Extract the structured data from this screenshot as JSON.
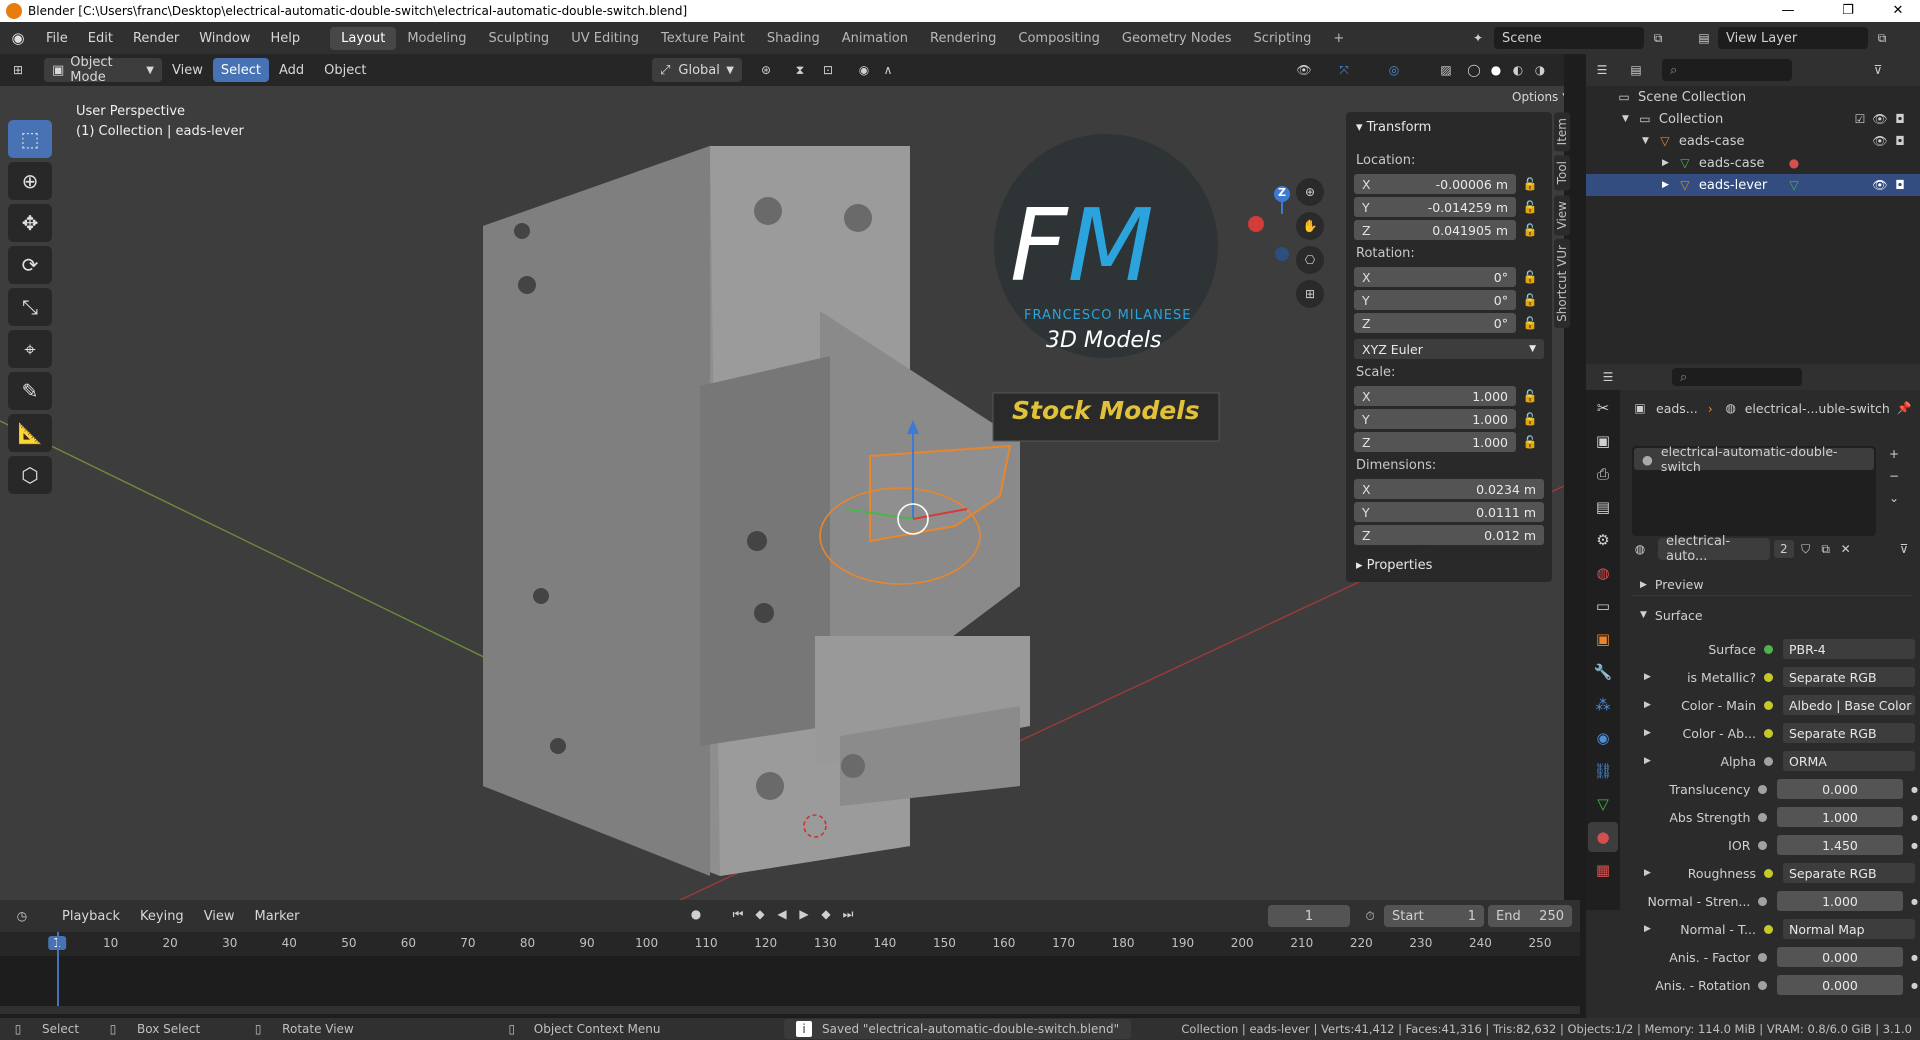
{
  "titlebar": {
    "title": "Blender [C:\\Users\\franc\\Desktop\\electrical-automatic-double-switch\\electrical-automatic-double-switch.blend]",
    "minimize": "—",
    "maximize": "❐",
    "close": "✕"
  },
  "menu": [
    "File",
    "Edit",
    "Render",
    "Window",
    "Help"
  ],
  "workspaces": [
    "Layout",
    "Modeling",
    "Sculpting",
    "UV Editing",
    "Texture Paint",
    "Shading",
    "Animation",
    "Rendering",
    "Compositing",
    "Geometry Nodes",
    "Scripting"
  ],
  "active_workspace": "Layout",
  "add_workspace": "+",
  "scene": {
    "label": "Scene"
  },
  "view_layer": {
    "label": "View Layer"
  },
  "viewport_header": {
    "mode": "Object Mode",
    "menus": [
      "View",
      "Select",
      "Add",
      "Object"
    ],
    "orientation": "Global",
    "options": "Options"
  },
  "viewport": {
    "perspective": "User Perspective",
    "collection_info": "(1) Collection | eads-lever",
    "watermark": {
      "initials_f": "F",
      "initials_m": "M",
      "name": "FRANCESCO MILANESE",
      "sub": "3D Models",
      "banner": "Stock Models"
    },
    "gizmo_axes": {
      "z": "Z"
    }
  },
  "npanel": {
    "header": "Transform",
    "location_label": "Location:",
    "location": [
      {
        "axis": "X",
        "value": "-0.00006 m"
      },
      {
        "axis": "Y",
        "value": "-0.014259 m"
      },
      {
        "axis": "Z",
        "value": "0.041905 m"
      }
    ],
    "rotation_label": "Rotation:",
    "rotation": [
      {
        "axis": "X",
        "value": "0°"
      },
      {
        "axis": "Y",
        "value": "0°"
      },
      {
        "axis": "Z",
        "value": "0°"
      }
    ],
    "rotation_mode": "XYZ Euler",
    "scale_label": "Scale:",
    "scale": [
      {
        "axis": "X",
        "value": "1.000"
      },
      {
        "axis": "Y",
        "value": "1.000"
      },
      {
        "axis": "Z",
        "value": "1.000"
      }
    ],
    "dimensions_label": "Dimensions:",
    "dimensions": [
      {
        "axis": "X",
        "value": "0.0234 m"
      },
      {
        "axis": "Y",
        "value": "0.0111 m"
      },
      {
        "axis": "Z",
        "value": "0.012 m"
      }
    ],
    "properties": "Properties",
    "side_tabs": [
      "Item",
      "Tool",
      "View",
      "Shortcut VUr"
    ]
  },
  "outliner": {
    "rows": [
      {
        "label": "Scene Collection",
        "indent": 0
      },
      {
        "label": "Collection",
        "indent": 1
      },
      {
        "label": "eads-case",
        "indent": 2
      },
      {
        "label": "eads-case",
        "indent": 3
      },
      {
        "label": "eads-lever",
        "indent": 3,
        "selected": true
      }
    ]
  },
  "properties": {
    "breadcrumb_obj": "eads...",
    "breadcrumb_mat": "electrical-...uble-switch",
    "material_slot": "electrical-automatic-double-switch",
    "material_name": "electrical-auto...",
    "user_count": "2",
    "preview": "Preview",
    "surface_header": "Surface",
    "rows": [
      {
        "label": "Surface",
        "value": "PBR-4",
        "socket": "#4db34d",
        "expand": false,
        "num": false
      },
      {
        "label": "is Metallic?",
        "value": "Separate RGB",
        "socket": "#c7c729",
        "expand": true,
        "num": false
      },
      {
        "label": "Color - Main",
        "value": "Albedo | Base Color",
        "socket": "#c7c729",
        "expand": true,
        "num": false
      },
      {
        "label": "Color - Ab...",
        "value": "Separate RGB",
        "socket": "#c7c729",
        "expand": true,
        "num": false
      },
      {
        "label": "Alpha",
        "value": "ORMA",
        "socket": "#a1a1a1",
        "expand": true,
        "num": false
      },
      {
        "label": "Translucency",
        "value": "0.000",
        "socket": "#a1a1a1",
        "expand": false,
        "num": true
      },
      {
        "label": "Abs Strength",
        "value": "1.000",
        "socket": "#a1a1a1",
        "expand": false,
        "num": true
      },
      {
        "label": "IOR",
        "value": "1.450",
        "socket": "#a1a1a1",
        "expand": false,
        "num": true
      },
      {
        "label": "Roughness",
        "value": "Separate RGB",
        "socket": "#c7c729",
        "expand": true,
        "num": false
      },
      {
        "label": "Normal - Stren...",
        "value": "1.000",
        "socket": "#a1a1a1",
        "expand": false,
        "num": true
      },
      {
        "label": "Normal - T...",
        "value": "Normal Map",
        "socket": "#c7c729",
        "expand": true,
        "num": false
      },
      {
        "label": "Anis. - Factor",
        "value": "0.000",
        "socket": "#a1a1a1",
        "expand": false,
        "num": true
      },
      {
        "label": "Anis. - Rotation",
        "value": "0.000",
        "socket": "#a1a1a1",
        "expand": false,
        "num": true
      }
    ]
  },
  "timeline": {
    "menus": [
      "Playback",
      "Keying",
      "View",
      "Marker"
    ],
    "current_frame": "1",
    "start_label": "Start",
    "start": "1",
    "end_label": "End",
    "end": "250",
    "ticks": [
      "1",
      "10",
      "20",
      "30",
      "40",
      "50",
      "60",
      "70",
      "80",
      "90",
      "100",
      "110",
      "120",
      "130",
      "140",
      "150",
      "160",
      "170",
      "180",
      "190",
      "200",
      "210",
      "220",
      "230",
      "240",
      "250"
    ]
  },
  "statusbar": {
    "select": "Select",
    "box_select": "Box Select",
    "rotate_view": "Rotate View",
    "context_menu": "Object Context Menu",
    "message": "Saved \"electrical-automatic-double-switch.blend\"",
    "stats": "Collection | eads-lever | Verts:41,412 | Faces:41,316 | Tris:82,632 | Objects:1/2 | Memory: 114.0 MiB | VRAM: 0.8/6.0 GiB | 3.1.0"
  },
  "colors": {
    "accent": "#4772b3",
    "selection_orange": "#e8862c",
    "bg": "#3d3d3d"
  }
}
